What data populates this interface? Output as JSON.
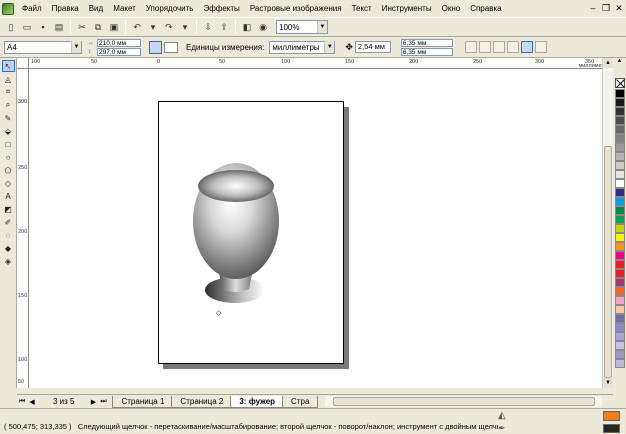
{
  "menubar": {
    "items": [
      "Файл",
      "Правка",
      "Вид",
      "Макет",
      "Упорядочить",
      "Эффекты",
      "Растровые изображения",
      "Текст",
      "Инструменты",
      "Окно",
      "Справка"
    ]
  },
  "toolbar": {
    "zoom": "100%"
  },
  "property_bar": {
    "page_size": "A4",
    "width": "210,0 мм",
    "height": "297,0 мм",
    "units_label": "Единицы измерения:",
    "units_value": "миллиметры",
    "nudge": "2,54 мм",
    "dup_x": "6,35 мм",
    "dup_y": "6,35 мм"
  },
  "rulers": {
    "unit": "миллиметры",
    "h_labels": [
      "100",
      "50",
      "0",
      "50",
      "100",
      "150",
      "200",
      "250",
      "300",
      "350"
    ],
    "v_labels": [
      "300",
      "250",
      "200",
      "150",
      "100",
      "50"
    ]
  },
  "palette": {
    "colors": [
      "#000000",
      "#1a1a1a",
      "#333333",
      "#4d4d4d",
      "#666666",
      "#808080",
      "#999999",
      "#b3b3b3",
      "#cccccc",
      "#e6e6e6",
      "#ffffff",
      "#2b2e8f",
      "#00a0e0",
      "#008a45",
      "#00a650",
      "#c8d400",
      "#fff200",
      "#f7941d",
      "#ec008c",
      "#ed1c24",
      "#e31e24",
      "#a8326b",
      "#f26522",
      "#f5a3c7",
      "#fbc4a4",
      "#6d6ea8",
      "#8c8cc6",
      "#a6a6d8",
      "#c7c0e0",
      "#9e9ac8",
      "#bcb8de"
    ]
  },
  "page_nav": {
    "counter": "3 из 5",
    "tabs": [
      "Страница 1",
      "Страница 2",
      "3: фужер",
      "Стра"
    ]
  },
  "status": {
    "coords": "( 500,475; 313,335 )",
    "hint": "Следующий щелчок - перетаскивание/масштабирование; второй щелчок - поворот/наклон; инструмент с двойным щелчком выбира...",
    "fill_color": "#f57f16",
    "outline_color": "#2a2622"
  }
}
